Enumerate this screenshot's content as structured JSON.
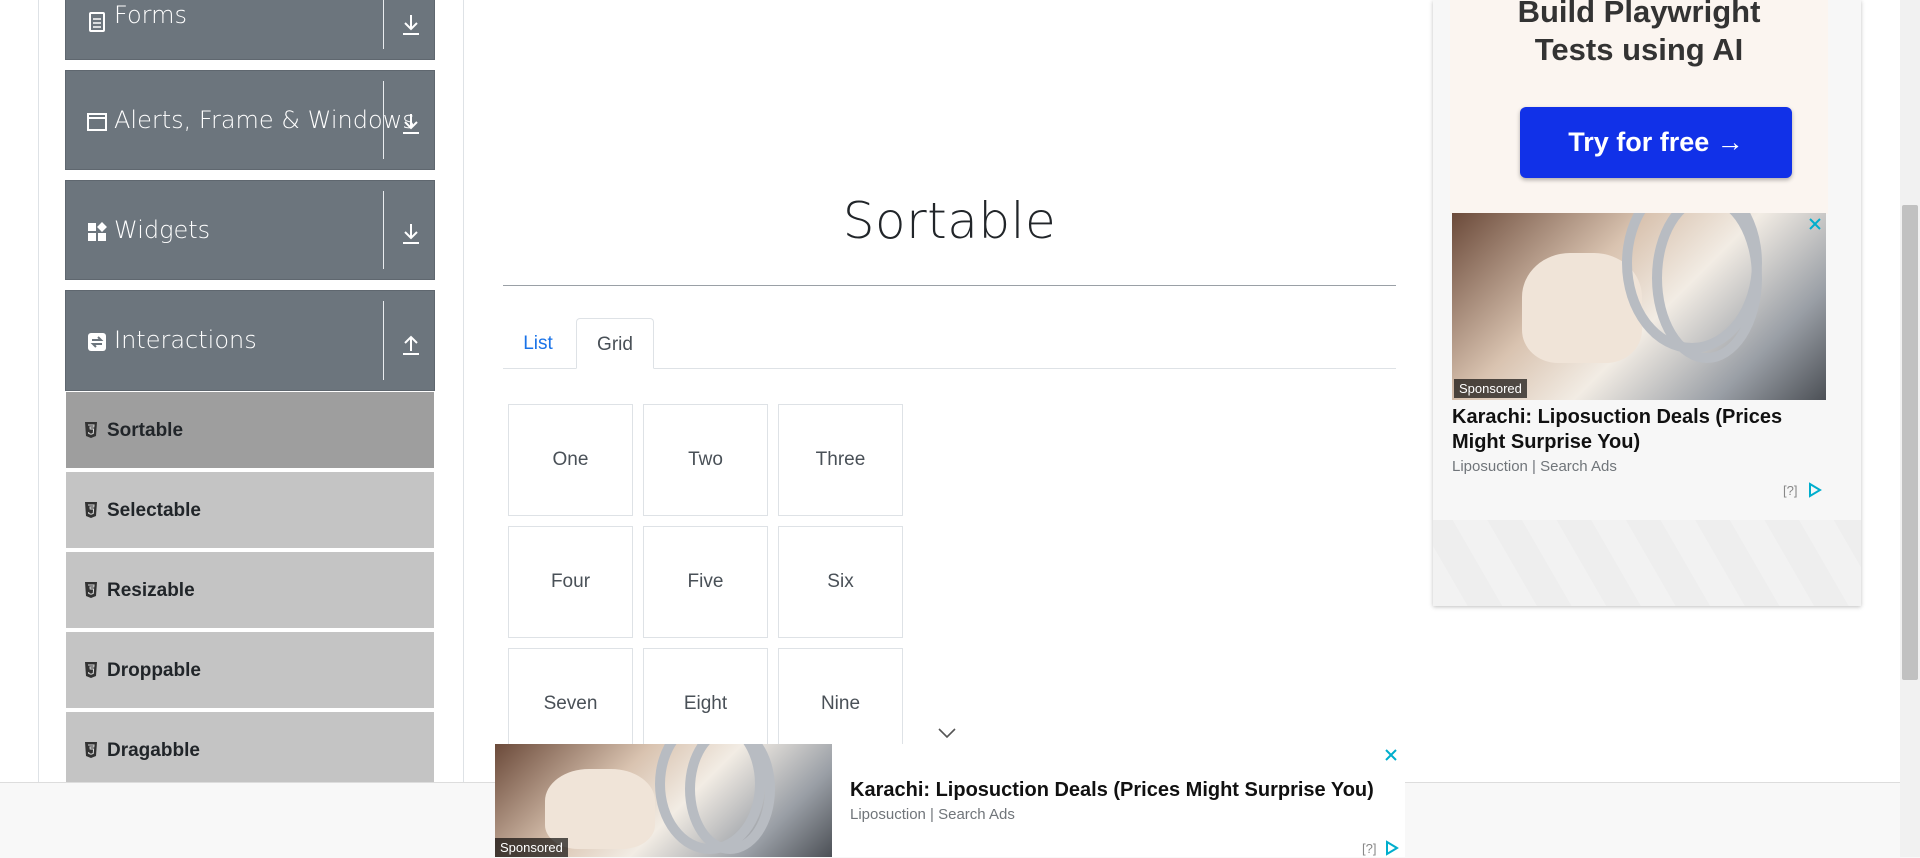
{
  "sidebar": {
    "groups": [
      {
        "label": "Forms",
        "icon": "document-icon",
        "arrow": "download-arrow-icon"
      },
      {
        "label": "Alerts, Frame & Windows",
        "icon": "window-icon",
        "arrow": "download-arrow-icon"
      },
      {
        "label": "Widgets",
        "icon": "widgets-icon",
        "arrow": "download-arrow-icon"
      },
      {
        "label": "Interactions",
        "icon": "interactions-icon",
        "arrow": "upload-arrow-icon"
      }
    ],
    "items": [
      {
        "label": "Sortable",
        "active": true
      },
      {
        "label": "Selectable",
        "active": false
      },
      {
        "label": "Resizable",
        "active": false
      },
      {
        "label": "Droppable",
        "active": false
      },
      {
        "label": "Dragabble",
        "active": false
      }
    ]
  },
  "main": {
    "title": "Sortable",
    "tabs": [
      {
        "label": "List",
        "active": false
      },
      {
        "label": "Grid",
        "active": true
      }
    ],
    "grid": [
      "One",
      "Two",
      "Three",
      "Four",
      "Five",
      "Six",
      "Seven",
      "Eight",
      "Nine"
    ]
  },
  "ad_right": {
    "headline_line1": "Build Playwright",
    "headline_line2": "Tests using AI",
    "cta": "Try for free →",
    "sponsored": "Sponsored",
    "title": "Karachi: Liposuction Deals (Prices Might Surprise You)",
    "source": "Liposuction | Search Ads",
    "info": "[?]"
  },
  "ad_bottom": {
    "sponsored": "Sponsored",
    "title": "Karachi: Liposuction Deals (Prices Might Surprise You)",
    "source": "Liposuction | Search Ads",
    "info": "[?]"
  },
  "colors": {
    "sidebar_header": "#6c757d",
    "menu_item": "#c4c4c4",
    "menu_item_active": "#9e9e9e",
    "tab_link": "#1a73e8",
    "cta_button": "#1131e8",
    "adchoices": "#00aecd"
  }
}
